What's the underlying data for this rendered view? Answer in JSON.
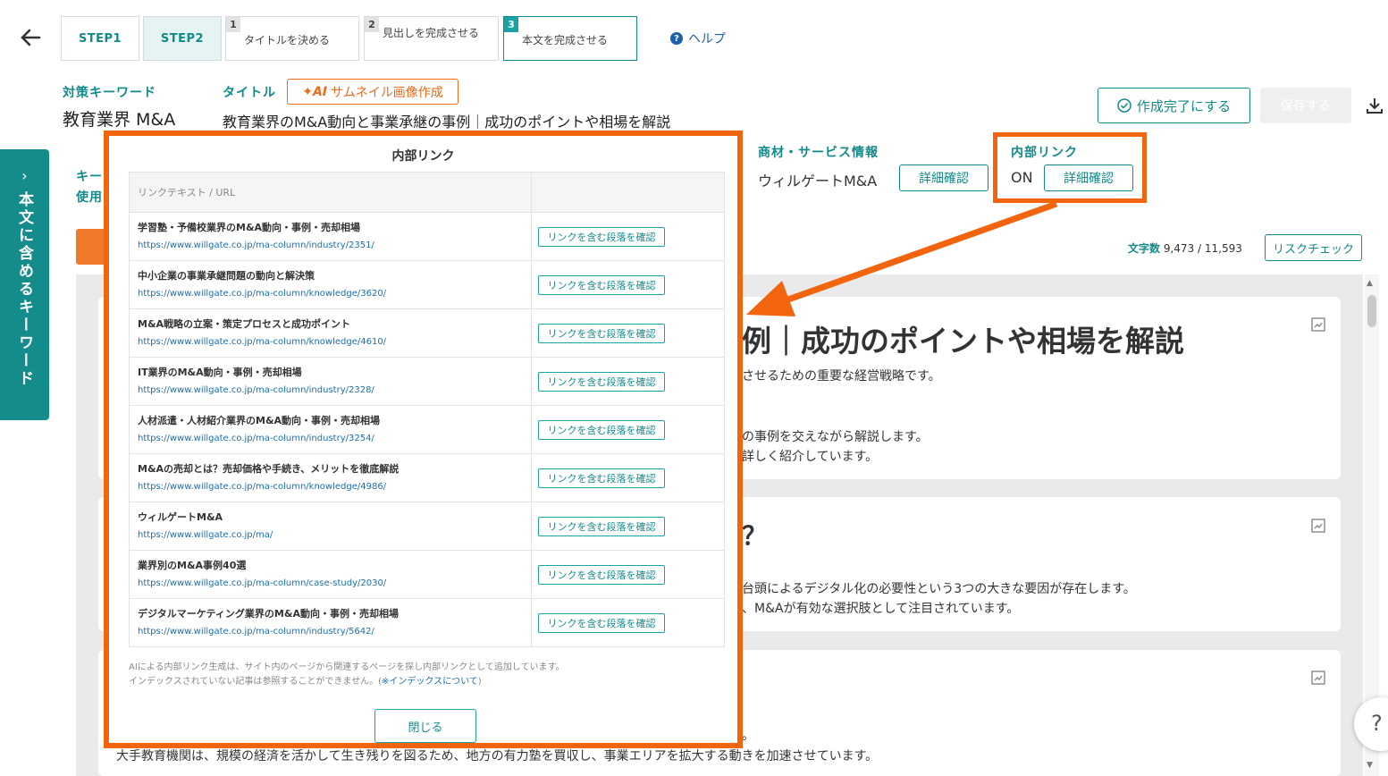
{
  "header": {
    "steps": [
      "STEP1",
      "STEP2"
    ],
    "substeps": [
      {
        "num": "1",
        "label": "タイトルを決める"
      },
      {
        "num": "2",
        "label": "見出しを完成させる"
      },
      {
        "num": "3",
        "label": "本文を完成させる"
      }
    ],
    "help": "ヘルプ"
  },
  "meta": {
    "keyword_label": "対策キーワード",
    "keyword": "教育業界 M&A",
    "title_label": "タイトル",
    "thumbnail_btn": "サムネイル画像作成",
    "title": "教育業界のM&A動向と事業承継の事例｜成功のポイントや相場を解説",
    "complete_btn": "作成完了にする",
    "save_btn": "保存する"
  },
  "info": {
    "product_label": "商材・サービス情報",
    "product_value": "ウィルゲートM&A",
    "product_btn": "詳細確認",
    "internal_label": "内部リンク",
    "internal_value": "ON",
    "internal_btn": "詳細確認",
    "kw_label_partial": "キー",
    "use_label_partial": "使用",
    "char_count_label": "文字数",
    "char_count": "9,473 / 11,593",
    "risk_btn": "リスクチェック"
  },
  "side_tab": {
    "label": "本文に含めるキーワード"
  },
  "content": {
    "heading_partial": "例｜成功のポイントや相場を解説",
    "p1": "させるための重要な経営戦略です。",
    "p2": "の事例を交えながら解説します。",
    "p3": "詳しく紹介しています。",
    "h2_partial": "？",
    "p4": "台頭によるデジタル化の必要性という3つの大きな要因が存在します。",
    "p5": "、M&Aが有効な選択肢として注目されています。",
    "p6_partial": "。",
    "bottom_line": "大手教育機関は、規模の経済を活かして生き残りを図るため、地方の有力塾を買収し、事業エリアを拡大する動きを加速させています。"
  },
  "modal": {
    "title": "内部リンク",
    "col_header": "リンクテキスト / URL",
    "check_label": "リンクを含む段落を確認",
    "links": [
      {
        "title": "学習塾・予備校業界のM&A動向・事例・売却相場",
        "url": "https://www.willgate.co.jp/ma-column/industry/2351/"
      },
      {
        "title": "中小企業の事業承継問題の動向と解決策",
        "url": "https://www.willgate.co.jp/ma-column/knowledge/3620/"
      },
      {
        "title": "M&A戦略の立案・策定プロセスと成功ポイント",
        "url": "https://www.willgate.co.jp/ma-column/knowledge/4610/"
      },
      {
        "title": "IT業界のM&A動向・事例・売却相場",
        "url": "https://www.willgate.co.jp/ma-column/industry/2328/"
      },
      {
        "title": "人材派遣・人材紹介業界のM&A動向・事例・売却相場",
        "url": "https://www.willgate.co.jp/ma-column/industry/3254/"
      },
      {
        "title": "M&Aの売却とは？売却価格や手続き、メリットを徹底解説",
        "url": "https://www.willgate.co.jp/ma-column/knowledge/4986/"
      },
      {
        "title": "ウィルゲートM&A",
        "url": "https://www.willgate.co.jp/ma/"
      },
      {
        "title": "業界別のM&A事例40選",
        "url": "https://www.willgate.co.jp/ma-column/case-study/2030/"
      },
      {
        "title": "デジタルマーケティング業界のM&A動向・事例・売却相場",
        "url": "https://www.willgate.co.jp/ma-column/industry/5642/"
      }
    ],
    "note_line1": "AIによる内部リンク生成は、サイト内のページから関連するページを探し内部リンクとして追加しています。",
    "note_line2": "インデックスされていない記事は参照することができません。(",
    "note_link": "※インデックスについて",
    "note_end": ")",
    "close_btn": "閉じる"
  },
  "colors": {
    "teal": "#118a8a",
    "orange": "#f2640d",
    "link": "#1a6fb0"
  }
}
